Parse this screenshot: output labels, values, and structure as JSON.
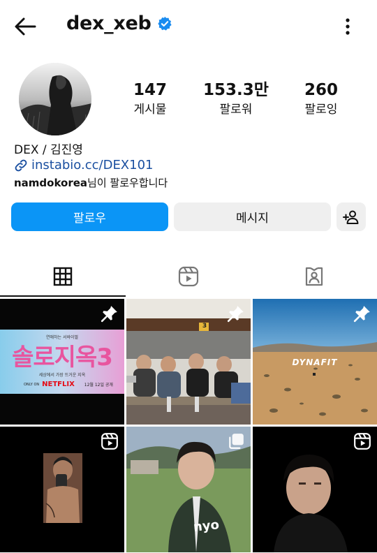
{
  "header": {
    "username": "dex_xeb"
  },
  "stats": [
    {
      "value": "147",
      "label": "게시물"
    },
    {
      "value": "153.3만",
      "label": "팔로워"
    },
    {
      "value": "260",
      "label": "팔로잉"
    }
  ],
  "bio": {
    "full_name": "DEX / 김진영",
    "link": "instabio.cc/DEX101",
    "followed_by_user": "namdokorea",
    "followed_by_suffix": "님이 팔로우합니다"
  },
  "actions": {
    "follow_label": "팔로우",
    "message_label": "메시지"
  },
  "tabs": [
    "grid",
    "reels",
    "tagged"
  ],
  "posts": [
    {
      "caption_small": "연애하는 서바이벌",
      "title": "솔로지옥3",
      "subtitle": "세상에서 가장 뜨거운 지옥",
      "only_on": "ONLY ON",
      "netflix": "NETFLIX",
      "date": "12월 12일 공개",
      "badge": "pin-icon"
    },
    {
      "badge": "pin-icon",
      "sign": "3"
    },
    {
      "badge": "pin-icon",
      "brand": "DYNAFIT"
    },
    {
      "badge": "reels-icon"
    },
    {
      "badge": "carousel-icon",
      "shirt_text": "nyo"
    },
    {
      "badge": "reels-icon"
    }
  ],
  "colors": {
    "accent": "#0b95f6",
    "verified": "#1a8cf0",
    "link": "#1a4fa0"
  }
}
